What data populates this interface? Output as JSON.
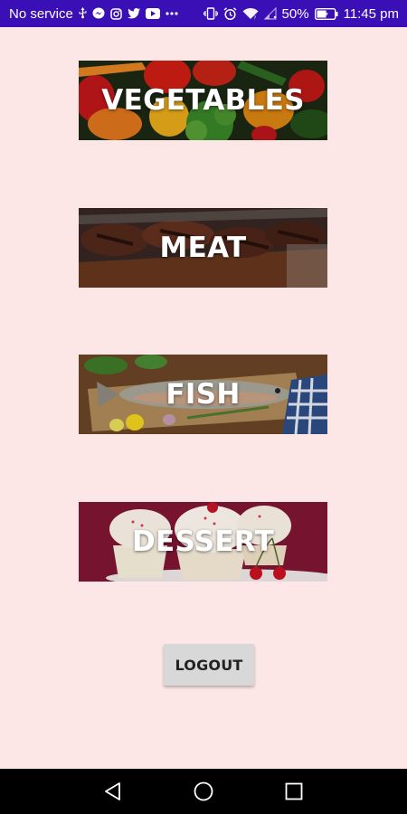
{
  "status_bar": {
    "carrier": "No service",
    "battery": "50%",
    "time": "11:45 pm",
    "left_icons": [
      "usb-icon",
      "messenger-icon",
      "instagram-icon",
      "twitter-icon",
      "youtube-icon",
      "more-icon"
    ],
    "right_icons": [
      "vibrate-icon",
      "alarm-icon",
      "wifi-icon",
      "signal-icon",
      "battery-icon"
    ],
    "colors": {
      "background": "#3a0fb5",
      "text": "#ffffff"
    }
  },
  "categories": [
    {
      "label": "VEGETABLES"
    },
    {
      "label": "MEAT"
    },
    {
      "label": "FISH"
    },
    {
      "label": "DESSERT"
    }
  ],
  "logout": {
    "label": "LOGOUT"
  },
  "nav_bar": {
    "icons": [
      "back-icon",
      "home-icon",
      "recents-icon"
    ]
  },
  "colors": {
    "page_background": "#fde6e6",
    "button_background": "#d8d8d8"
  }
}
